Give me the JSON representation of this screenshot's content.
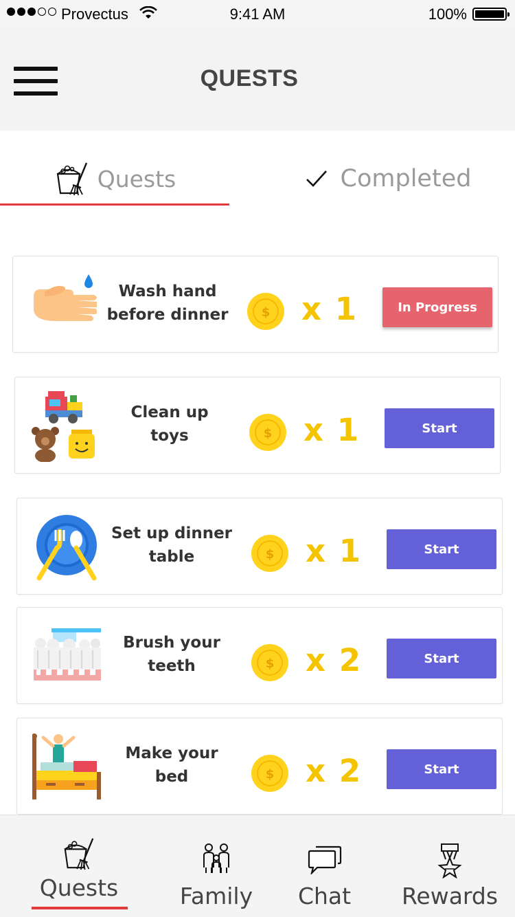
{
  "status_bar": {
    "carrier": "Provectus",
    "time": "9:41 AM",
    "battery": "100%"
  },
  "header": {
    "title": "QUESTS"
  },
  "tabs": [
    {
      "label": "Quests",
      "active": true
    },
    {
      "label": "Completed",
      "active": false
    }
  ],
  "quests": [
    {
      "title_line1": "Wash hand",
      "title_line2": "before dinner",
      "reward": "x 1",
      "action": "In Progress",
      "status": "in-progress",
      "icon": "wash-hand-icon"
    },
    {
      "title_line1": "Clean up",
      "title_line2": "toys",
      "reward": "x 1",
      "action": "Start",
      "status": "start",
      "icon": "toys-icon"
    },
    {
      "title_line1": "Set up dinner",
      "title_line2": "table",
      "reward": "x 1",
      "action": "Start",
      "status": "start",
      "icon": "dinner-plate-icon"
    },
    {
      "title_line1": "Brush your",
      "title_line2": "teeth",
      "reward": "x 2",
      "action": "Start",
      "status": "start",
      "icon": "teeth-brush-icon"
    },
    {
      "title_line1": "Make your",
      "title_line2": "bed",
      "reward": "x 2",
      "action": "Start",
      "status": "start",
      "icon": "bed-icon"
    }
  ],
  "bottom_nav": [
    {
      "label": "Quests",
      "icon": "cleaning-bucket-icon",
      "active": true
    },
    {
      "label": "Family",
      "icon": "family-icon",
      "active": false
    },
    {
      "label": "Chat",
      "icon": "chat-bubbles-icon",
      "active": false
    },
    {
      "label": "Rewards",
      "icon": "medal-icon",
      "active": false
    }
  ],
  "colors": {
    "accent_red": "#e23b3b",
    "start_button": "#6461d8",
    "in_progress_button": "#e5646e",
    "coin_yellow": "#f5c400"
  }
}
